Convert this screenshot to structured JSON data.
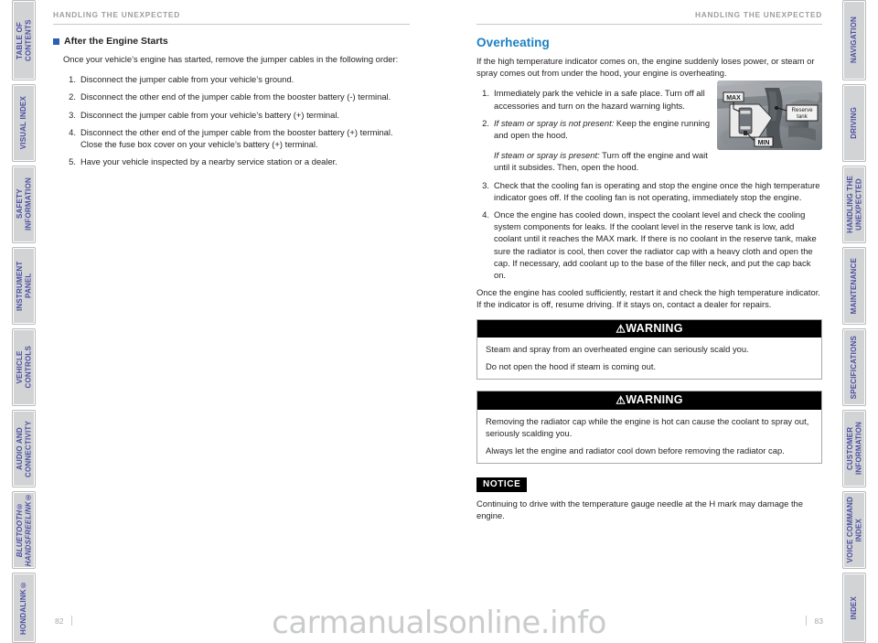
{
  "colors": {
    "tab_text": "#4a4fa0",
    "tab_face": "#d2d3d5",
    "section_heading": "#1b80c4",
    "bullet": "#2f5fb5",
    "running_head": "#9b9d9f"
  },
  "left_tabs": [
    {
      "label": "TABLE OF CONTENTS",
      "italic": false
    },
    {
      "label": "VISUAL INDEX",
      "italic": false
    },
    {
      "label": "SAFETY\nINFORMATION",
      "italic": false
    },
    {
      "label": "INSTRUMENT PANEL",
      "italic": false
    },
    {
      "label": "VEHICLE\nCONTROLS",
      "italic": false
    },
    {
      "label": "AUDIO AND\nCONNECTIVITY",
      "italic": false
    },
    {
      "label": "BLUETOOTH®\nHANDSFREELINK®",
      "italic": true
    },
    {
      "label": "HONDALINK®",
      "italic": false
    }
  ],
  "right_tabs": [
    {
      "label": "NAVIGATION"
    },
    {
      "label": "DRIVING"
    },
    {
      "label": "HANDLING THE\nUNEXPECTED"
    },
    {
      "label": "MAINTENANCE"
    },
    {
      "label": "SPECIFICATIONS"
    },
    {
      "label": "CUSTOMER\nINFORMATION"
    },
    {
      "label": "VOICE COMMAND\nINDEX"
    },
    {
      "label": "INDEX"
    }
  ],
  "left_page": {
    "running_head": "HANDLING THE UNEXPECTED",
    "sub_heading": "After the Engine Starts",
    "intro": "Once your vehicle’s engine has started, remove the jumper cables in the following order:",
    "steps": [
      {
        "num": "1.",
        "text": "Disconnect the jumper cable from your vehicle’s ground."
      },
      {
        "num": "2.",
        "text": "Disconnect the other end of the jumper cable from the booster battery (-) terminal."
      },
      {
        "num": "3.",
        "text": "Disconnect the jumper cable from your vehicle’s battery (+) terminal."
      },
      {
        "num": "4.",
        "text": "Disconnect the other end of the jumper cable from the booster battery (+) terminal. Close the fuse box cover on your vehicle’s battery (+) terminal."
      },
      {
        "num": "5.",
        "text": "Have your vehicle inspected by a nearby service station or a dealer."
      }
    ],
    "folio": "82"
  },
  "right_page": {
    "running_head": "HANDLING THE UNEXPECTED",
    "section_heading": "Overheating",
    "intro": "If the high temperature indicator comes on, the engine suddenly loses power, or steam or spray comes out from under the hood, your engine is overheating.",
    "steps": [
      {
        "num": "1.",
        "text": "Immediately park the vehicle in a safe place. Turn off all accessories and turn on the hazard warning lights.",
        "italic_lead": "",
        "extra_italic_lead": "",
        "extra_text": ""
      },
      {
        "num": "2.",
        "italic_lead": "If steam or spray is not present:",
        "text": " Keep the engine running and open the hood.",
        "extra_italic_lead": "If steam or spray is present:",
        "extra_text": " Turn off the engine and wait until it subsides. Then, open the hood."
      },
      {
        "num": "3.",
        "italic_lead": "",
        "text": "Check that the cooling fan is operating and stop the engine once the high temperature indicator goes off. If the cooling fan is not operating, immediately stop the engine.",
        "extra_italic_lead": "",
        "extra_text": ""
      },
      {
        "num": "4.",
        "italic_lead": "",
        "text": "Once the engine has cooled down, inspect the coolant level and check the cooling system components for leaks. If the coolant level in the reserve tank is low, add coolant until it reaches the MAX mark. If there is no coolant in the reserve tank, make sure the radiator is cool, then cover the radiator cap with a heavy cloth and open the cap. If necessary, add coolant up to the base of the filler neck, and put the cap back on.",
        "extra_italic_lead": "",
        "extra_text": ""
      }
    ],
    "closing": "Once the engine has cooled sufficiently, restart it and check the high temperature indicator. If the indicator is off, resume driving. If it stays on, contact a dealer for repairs.",
    "figure": {
      "callout_max": "MAX",
      "callout_min": "MIN",
      "callout_reserve_tank": "Reserve\ntank"
    },
    "warnings": [
      {
        "title": "WARNING",
        "lines": [
          "Steam and spray from an overheated engine can seriously scald you.",
          "Do not open the hood if steam is coming out."
        ]
      },
      {
        "title": "WARNING",
        "lines": [
          "Removing the radiator cap while the engine is hot can cause the coolant to spray out, seriously scalding you.",
          "Always let the engine and radiator cool down before removing the radiator cap."
        ]
      }
    ],
    "notice": {
      "badge": "NOTICE",
      "text": "Continuing to drive with the temperature gauge needle at the H mark may damage the engine."
    },
    "folio": "83"
  },
  "watermark": "carmanualsonline.info"
}
